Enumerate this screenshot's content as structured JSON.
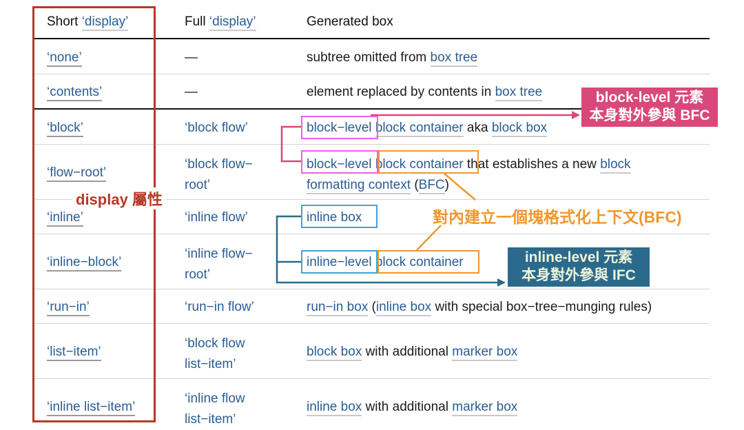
{
  "table": {
    "headers": {
      "short_prefix": "Short",
      "short_quoted": "‘display’",
      "full_prefix": "Full",
      "full_quoted": "‘display’",
      "generated": "Generated box"
    },
    "rows": [
      {
        "short": "‘none’",
        "full": "—",
        "generated": [
          {
            "t": "subtree omitted from "
          },
          {
            "t": "box tree",
            "link": true
          }
        ]
      },
      {
        "short": "‘contents’",
        "full": "—",
        "generated": [
          {
            "t": "element replaced by contents in "
          },
          {
            "t": "box tree",
            "link": true
          }
        ]
      },
      {
        "short": "‘block’",
        "full": "‘block flow’",
        "generated_parts": [
          "block−level",
          "block container",
          "aka",
          "block box"
        ]
      },
      {
        "short": "‘flow−root’",
        "full_lines": [
          "‘block flow−",
          "root’"
        ],
        "generated_parts": [
          "block−level",
          "block container",
          "that establishes a new",
          "block",
          "formatting context",
          "(",
          "BFC",
          ")"
        ]
      },
      {
        "short": "‘inline’",
        "full": "‘inline flow’",
        "generated_parts": [
          "inline box"
        ]
      },
      {
        "short": "‘inline−block’",
        "full_lines": [
          "‘inline flow−",
          "root’"
        ],
        "generated_parts": [
          "inline−level",
          "block container"
        ]
      },
      {
        "short": "‘run−in’",
        "full": "‘run−in flow’",
        "generated_parts": [
          "run−in box",
          "(",
          "inline box",
          "with special box−tree−munging rules)"
        ]
      },
      {
        "short": "‘list−item’",
        "full_lines": [
          "‘block flow",
          "list−item’"
        ],
        "generated_parts": [
          "block box",
          "with additional",
          "marker box"
        ]
      },
      {
        "short": "‘inline list−item’",
        "full_lines": [
          "‘inline flow",
          "list−item’"
        ],
        "generated_parts": [
          "inline box",
          "with additional",
          "marker box"
        ]
      }
    ]
  },
  "annotations": {
    "display_property": "display 屬性",
    "block_level_callout": [
      "block-level 元素",
      "本身對外參與 BFC"
    ],
    "inline_level_callout": [
      "inline-level 元素",
      "本身對外參與 IFC"
    ],
    "bfc_inside_note": "對內建立一個塊格式化上下文(BFC)"
  },
  "colors": {
    "link_blue": "#2a5d93",
    "frame_red": "#b63a26",
    "magenta": "#ee5bf0",
    "pink": "#d9487a",
    "orange": "#f0962f",
    "light_blue": "#3fa2d6",
    "teal": "#2b6a8c"
  }
}
